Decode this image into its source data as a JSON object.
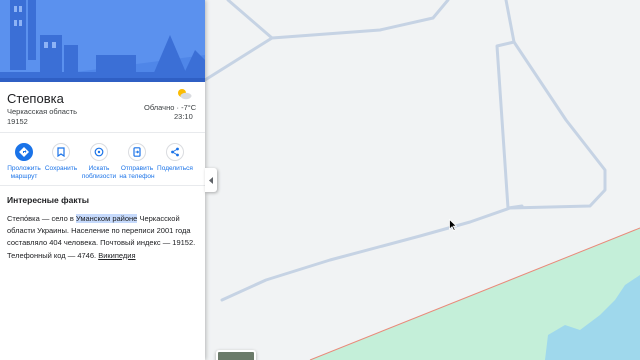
{
  "place": {
    "name": "Степовка",
    "region": "Черкасская область",
    "postal_code": "19152"
  },
  "weather": {
    "condition": "Облачно",
    "temperature": "-7°C",
    "time": "23:10",
    "icon": "partly-cloudy-icon"
  },
  "actions": [
    {
      "label_line1": "Проложить",
      "label_line2": "маршрут",
      "icon": "directions-icon"
    },
    {
      "label_line1": "Сохранить",
      "label_line2": "",
      "icon": "bookmark-icon"
    },
    {
      "label_line1": "Искать",
      "label_line2": "поблизости",
      "icon": "nearby-icon"
    },
    {
      "label_line1": "Отправить",
      "label_line2": "на телефон",
      "icon": "send-to-phone-icon"
    },
    {
      "label_line1": "Поделиться",
      "label_line2": "",
      "icon": "share-icon"
    }
  ],
  "facts": {
    "title": "Интересные факты",
    "text_before": "Степо́вка — село в ",
    "highlight": "Уманском районе",
    "text_after": " Черкасской области Украины. Население по переписи 2001 года составляло 404 человека. Почтовый индекс — 19152. Телефонный код — 4746. ",
    "link": "Википедия"
  },
  "colors": {
    "accent": "#1a73e8",
    "hero_background": "#4f86e8",
    "map_background": "#f1f3f4",
    "road": "#c6d3e4",
    "park": "#c4efd9",
    "water": "#9fd8ec",
    "boundary": "#e98a7a"
  }
}
